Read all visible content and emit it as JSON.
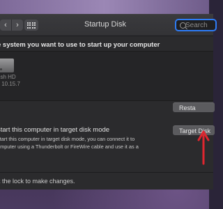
{
  "window": {
    "title": "Startup Disk"
  },
  "toolbar": {
    "back_icon": "chevron-left-icon",
    "forward_icon": "chevron-right-icon",
    "grid_icon": "grid-icon"
  },
  "search": {
    "placeholder": "Search",
    "icon": "search-icon",
    "focus_color": "#2e7cf6"
  },
  "main": {
    "heading": "e system you want to use to start up your computer",
    "disk": {
      "name": "osh HD",
      "version": "x 10.15.7",
      "icon": "hard-disk-icon"
    },
    "restart_label": "Resta",
    "target_mode": {
      "title": "start this computer in target disk mode",
      "desc_lines": [
        "start this computer in target disk mode, you can connect it to",
        "omputer using a Thunderbolt or FireWire cable and use it as a"
      ],
      "button_label": "Target Disk"
    }
  },
  "footer": {
    "lock_text": "k the lock to make changes."
  },
  "annotation": {
    "arrow_color": "#e0262f"
  }
}
